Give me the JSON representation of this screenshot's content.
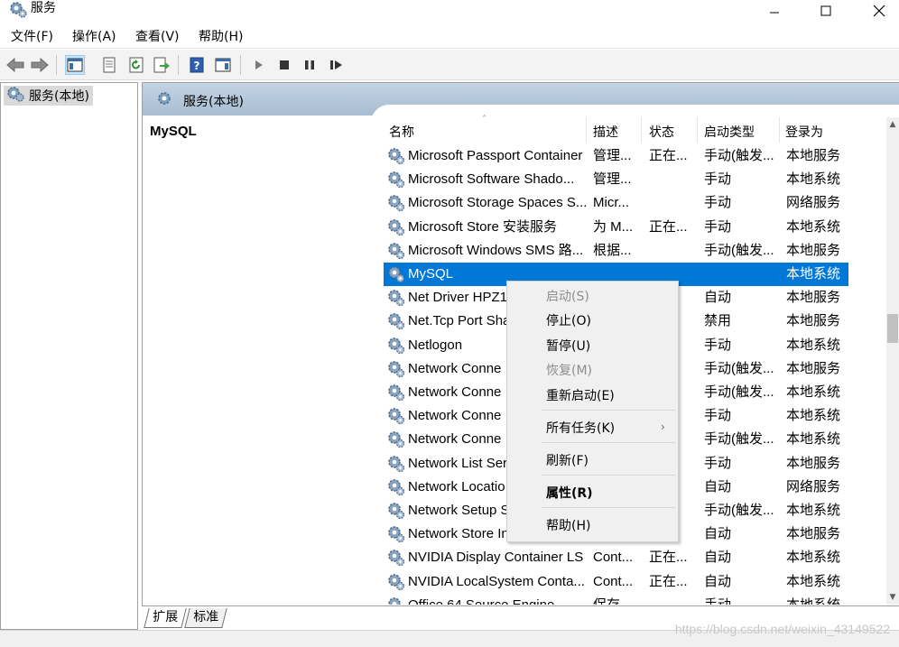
{
  "window": {
    "title": "服务"
  },
  "menubar": {
    "items": [
      "文件(F)",
      "操作(A)",
      "查看(V)",
      "帮助(H)"
    ]
  },
  "tree": {
    "root_label": "服务(本地)"
  },
  "pane": {
    "header_title": "服务(本地)",
    "selected_service": "MySQL"
  },
  "columns": [
    "名称",
    "描述",
    "状态",
    "启动类型",
    "登录为"
  ],
  "services": [
    {
      "name": "Microsoft Passport Container",
      "desc": "管理...",
      "status": "正在...",
      "start": "手动(触发...",
      "logon": "本地服务"
    },
    {
      "name": "Microsoft Software Shado...",
      "desc": "管理...",
      "status": "",
      "start": "手动",
      "logon": "本地系统"
    },
    {
      "name": "Microsoft Storage Spaces S...",
      "desc": "Micr...",
      "status": "",
      "start": "手动",
      "logon": "网络服务"
    },
    {
      "name": "Microsoft Store 安装服务",
      "desc": "为 M...",
      "status": "正在...",
      "start": "手动",
      "logon": "本地系统"
    },
    {
      "name": "Microsoft Windows SMS 路...",
      "desc": "根据...",
      "status": "",
      "start": "手动(触发...",
      "logon": "本地服务"
    },
    {
      "name": "MySQL",
      "desc": "",
      "status": "",
      "start": "",
      "logon": "本地系统",
      "selected": true
    },
    {
      "name": "Net Driver HPZ1",
      "desc": "",
      "status": "",
      "start": "自动",
      "logon": "本地服务"
    },
    {
      "name": "Net.Tcp Port Sha",
      "desc": "",
      "status": "",
      "start": "禁用",
      "logon": "本地服务"
    },
    {
      "name": "Netlogon",
      "desc": "",
      "status": "",
      "start": "手动",
      "logon": "本地系统"
    },
    {
      "name": "Network Conne",
      "desc": "",
      "status": "...",
      "start": "手动(触发...",
      "logon": "本地服务"
    },
    {
      "name": "Network Conne",
      "desc": "",
      "status": "...",
      "start": "手动(触发...",
      "logon": "本地系统"
    },
    {
      "name": "Network Conne",
      "desc": "",
      "status": "",
      "start": "手动",
      "logon": "本地系统"
    },
    {
      "name": "Network Conne",
      "desc": "",
      "status": "...",
      "start": "手动(触发...",
      "logon": "本地系统"
    },
    {
      "name": "Network List Ser",
      "desc": "",
      "status": "",
      "start": "手动",
      "logon": "本地服务"
    },
    {
      "name": "Network Locatio",
      "desc": "",
      "status": "",
      "start": "自动",
      "logon": "网络服务"
    },
    {
      "name": "Network Setup S",
      "desc": "",
      "status": "",
      "start": "手动(触发...",
      "logon": "本地系统"
    },
    {
      "name": "Network Store In",
      "desc": "",
      "status": "",
      "start": "自动",
      "logon": "本地服务"
    },
    {
      "name": "NVIDIA Display Container LS",
      "desc": "Cont...",
      "status": "正在...",
      "start": "自动",
      "logon": "本地系统"
    },
    {
      "name": "NVIDIA LocalSystem Conta...",
      "desc": "Cont...",
      "status": "正在...",
      "start": "自动",
      "logon": "本地系统"
    },
    {
      "name": "Office 64 Source Engine",
      "desc": "保存...",
      "status": "",
      "start": "手动",
      "logon": "本地系统"
    }
  ],
  "context_menu": [
    {
      "label": "启动(S)",
      "disabled": true
    },
    {
      "label": "停止(O)"
    },
    {
      "label": "暂停(U)"
    },
    {
      "label": "恢复(M)",
      "disabled": true
    },
    {
      "label": "重新启动(E)"
    },
    {
      "label": "所有任务(K)",
      "submenu": true
    },
    {
      "label": "刷新(F)"
    },
    {
      "label": "属性(R)",
      "bold": true
    },
    {
      "label": "帮助(H)"
    }
  ],
  "tabs": [
    "扩展",
    "标准"
  ],
  "watermark": "https://blog.csdn.net/weixin_43149522",
  "colors": {
    "selection": "#0078d7",
    "header": "#b4c7da"
  }
}
